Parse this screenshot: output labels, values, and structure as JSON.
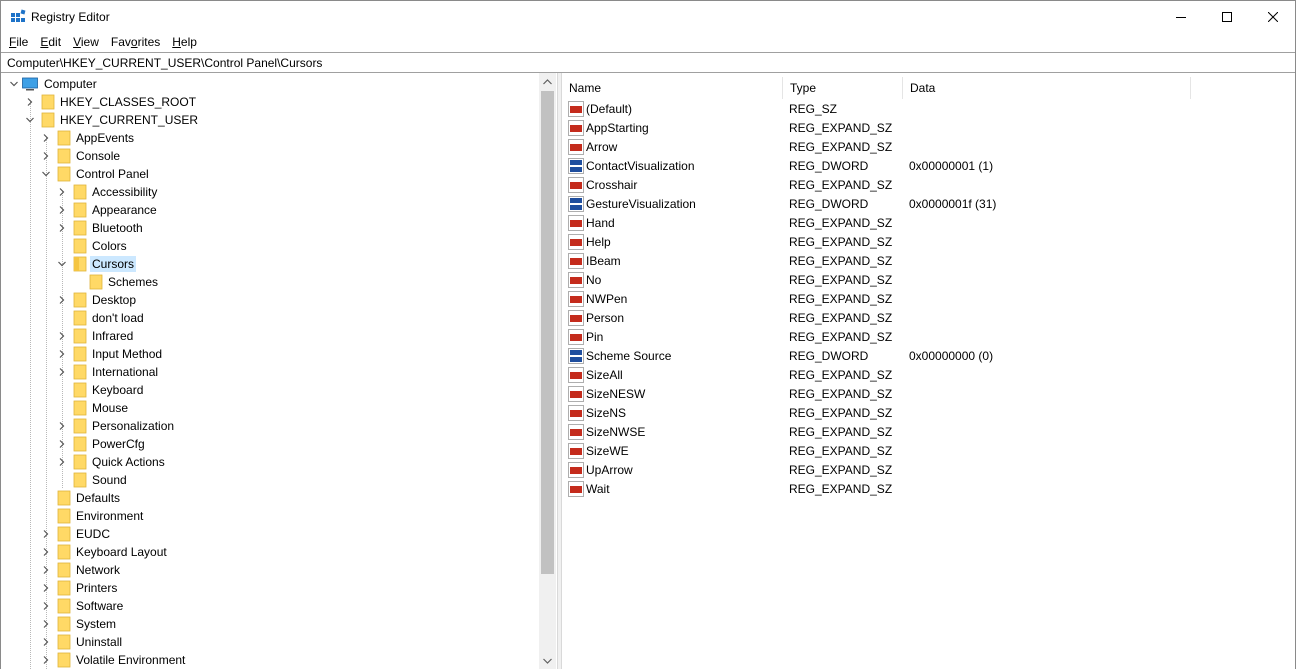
{
  "window": {
    "title": "Registry Editor",
    "controls": {
      "minimize": "minimize",
      "maximize": "maximize",
      "close": "close"
    }
  },
  "menu": [
    {
      "prefix": "",
      "accel": "F",
      "rest": "ile"
    },
    {
      "prefix": "",
      "accel": "E",
      "rest": "dit"
    },
    {
      "prefix": "",
      "accel": "V",
      "rest": "iew"
    },
    {
      "prefix": "Fav",
      "accel": "o",
      "rest": "rites"
    },
    {
      "prefix": "",
      "accel": "H",
      "rest": "elp"
    }
  ],
  "address": "Computer\\HKEY_CURRENT_USER\\Control Panel\\Cursors",
  "tree": [
    {
      "label": "Computer",
      "level": 0,
      "chevron": "down",
      "icon": "computer-icon"
    },
    {
      "label": "HKEY_CLASSES_ROOT",
      "level": 1,
      "chevron": "right",
      "icon": "folder-icon"
    },
    {
      "label": "HKEY_CURRENT_USER",
      "level": 1,
      "chevron": "down",
      "icon": "folder-icon"
    },
    {
      "label": "AppEvents",
      "level": 2,
      "chevron": "right",
      "icon": "folder-icon"
    },
    {
      "label": "Console",
      "level": 2,
      "chevron": "right",
      "icon": "folder-icon"
    },
    {
      "label": "Control Panel",
      "level": 2,
      "chevron": "down",
      "icon": "folder-icon"
    },
    {
      "label": "Accessibility",
      "level": 3,
      "chevron": "right",
      "icon": "folder-icon"
    },
    {
      "label": "Appearance",
      "level": 3,
      "chevron": "right",
      "icon": "folder-icon"
    },
    {
      "label": "Bluetooth",
      "level": 3,
      "chevron": "right",
      "icon": "folder-icon"
    },
    {
      "label": "Colors",
      "level": 3,
      "chevron": "",
      "icon": "folder-icon"
    },
    {
      "label": "Cursors",
      "level": 3,
      "chevron": "down",
      "icon": "folder-open-icon",
      "selected": true
    },
    {
      "label": "Schemes",
      "level": 4,
      "chevron": "",
      "icon": "folder-icon"
    },
    {
      "label": "Desktop",
      "level": 3,
      "chevron": "right",
      "icon": "folder-icon"
    },
    {
      "label": "don't load",
      "level": 3,
      "chevron": "",
      "icon": "folder-icon"
    },
    {
      "label": "Infrared",
      "level": 3,
      "chevron": "right",
      "icon": "folder-icon"
    },
    {
      "label": "Input Method",
      "level": 3,
      "chevron": "right",
      "icon": "folder-icon"
    },
    {
      "label": "International",
      "level": 3,
      "chevron": "right",
      "icon": "folder-icon"
    },
    {
      "label": "Keyboard",
      "level": 3,
      "chevron": "",
      "icon": "folder-icon"
    },
    {
      "label": "Mouse",
      "level": 3,
      "chevron": "",
      "icon": "folder-icon"
    },
    {
      "label": "Personalization",
      "level": 3,
      "chevron": "right",
      "icon": "folder-icon"
    },
    {
      "label": "PowerCfg",
      "level": 3,
      "chevron": "right",
      "icon": "folder-icon"
    },
    {
      "label": "Quick Actions",
      "level": 3,
      "chevron": "right",
      "icon": "folder-icon"
    },
    {
      "label": "Sound",
      "level": 3,
      "chevron": "",
      "icon": "folder-icon"
    },
    {
      "label": "Defaults",
      "level": 2,
      "chevron": "",
      "icon": "folder-icon"
    },
    {
      "label": "Environment",
      "level": 2,
      "chevron": "",
      "icon": "folder-icon"
    },
    {
      "label": "EUDC",
      "level": 2,
      "chevron": "right",
      "icon": "folder-icon"
    },
    {
      "label": "Keyboard Layout",
      "level": 2,
      "chevron": "right",
      "icon": "folder-icon"
    },
    {
      "label": "Network",
      "level": 2,
      "chevron": "right",
      "icon": "folder-icon"
    },
    {
      "label": "Printers",
      "level": 2,
      "chevron": "right",
      "icon": "folder-icon"
    },
    {
      "label": "Software",
      "level": 2,
      "chevron": "right",
      "icon": "folder-icon"
    },
    {
      "label": "System",
      "level": 2,
      "chevron": "right",
      "icon": "folder-icon"
    },
    {
      "label": "Uninstall",
      "level": 2,
      "chevron": "right",
      "icon": "folder-icon"
    },
    {
      "label": "Volatile Environment",
      "level": 2,
      "chevron": "right",
      "icon": "folder-icon"
    }
  ],
  "list": {
    "columns": [
      "Name",
      "Type",
      "Data"
    ],
    "rows": [
      {
        "name": "(Default)",
        "type": "REG_SZ",
        "data": "",
        "icon": "string-value-icon"
      },
      {
        "name": "AppStarting",
        "type": "REG_EXPAND_SZ",
        "data": "",
        "icon": "string-value-icon"
      },
      {
        "name": "Arrow",
        "type": "REG_EXPAND_SZ",
        "data": "",
        "icon": "string-value-icon"
      },
      {
        "name": "ContactVisualization",
        "type": "REG_DWORD",
        "data": "0x00000001 (1)",
        "icon": "binary-value-icon"
      },
      {
        "name": "Crosshair",
        "type": "REG_EXPAND_SZ",
        "data": "",
        "icon": "string-value-icon"
      },
      {
        "name": "GestureVisualization",
        "type": "REG_DWORD",
        "data": "0x0000001f (31)",
        "icon": "binary-value-icon"
      },
      {
        "name": "Hand",
        "type": "REG_EXPAND_SZ",
        "data": "",
        "icon": "string-value-icon"
      },
      {
        "name": "Help",
        "type": "REG_EXPAND_SZ",
        "data": "",
        "icon": "string-value-icon"
      },
      {
        "name": "IBeam",
        "type": "REG_EXPAND_SZ",
        "data": "",
        "icon": "string-value-icon"
      },
      {
        "name": "No",
        "type": "REG_EXPAND_SZ",
        "data": "",
        "icon": "string-value-icon"
      },
      {
        "name": "NWPen",
        "type": "REG_EXPAND_SZ",
        "data": "",
        "icon": "string-value-icon"
      },
      {
        "name": "Person",
        "type": "REG_EXPAND_SZ",
        "data": "",
        "icon": "string-value-icon"
      },
      {
        "name": "Pin",
        "type": "REG_EXPAND_SZ",
        "data": "",
        "icon": "string-value-icon"
      },
      {
        "name": "Scheme Source",
        "type": "REG_DWORD",
        "data": "0x00000000 (0)",
        "icon": "binary-value-icon"
      },
      {
        "name": "SizeAll",
        "type": "REG_EXPAND_SZ",
        "data": "",
        "icon": "string-value-icon"
      },
      {
        "name": "SizeNESW",
        "type": "REG_EXPAND_SZ",
        "data": "",
        "icon": "string-value-icon"
      },
      {
        "name": "SizeNS",
        "type": "REG_EXPAND_SZ",
        "data": "",
        "icon": "string-value-icon"
      },
      {
        "name": "SizeNWSE",
        "type": "REG_EXPAND_SZ",
        "data": "",
        "icon": "string-value-icon"
      },
      {
        "name": "SizeWE",
        "type": "REG_EXPAND_SZ",
        "data": "",
        "icon": "string-value-icon"
      },
      {
        "name": "UpArrow",
        "type": "REG_EXPAND_SZ",
        "data": "",
        "icon": "string-value-icon"
      },
      {
        "name": "Wait",
        "type": "REG_EXPAND_SZ",
        "data": "",
        "icon": "string-value-icon"
      }
    ]
  },
  "colors": {
    "selection": "#cce8ff",
    "folder": "#ffd966",
    "string_icon": "#c42b1c",
    "binary_icon": "#1f4e9e"
  }
}
